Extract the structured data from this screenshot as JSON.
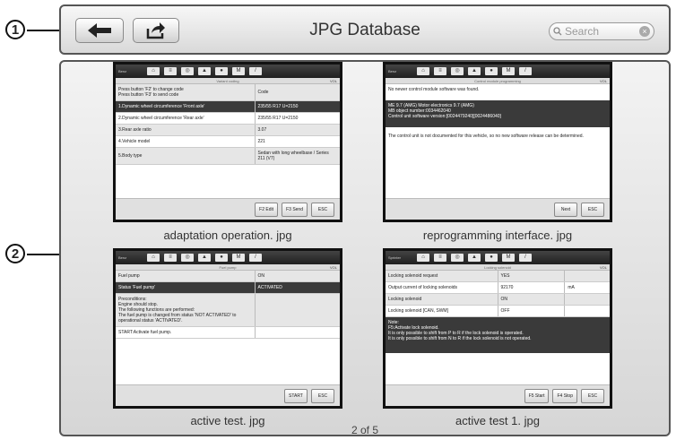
{
  "callouts": {
    "one": "1",
    "two": "2"
  },
  "toolbar": {
    "title": "JPG Database",
    "search_placeholder": "Search",
    "back_icon": "back-arrow-icon",
    "share_icon": "share-icon",
    "clear_icon": "clear-icon"
  },
  "thumbnails": [
    {
      "caption": "adaptation operation. jpg",
      "subtitle": "Variant coding",
      "header": [
        "Press button 'F2' to change code\nPress button 'F3' to send code",
        "Code"
      ],
      "rows": [
        [
          "1.Dynamic wheel circumference 'Front axle'",
          "235/55 R17 U=2150"
        ],
        [
          "2.Dynamic wheel circumference 'Rear axle'",
          "235/55 R17 U=2150"
        ],
        [
          "3.Rear axle ratio",
          "3.07"
        ],
        [
          "4.Vehicle model",
          "221"
        ],
        [
          "5.Body type",
          "Sedan with long wheelbase / Series 211 (V7)"
        ]
      ],
      "buttons": [
        "F2 Edit",
        "F3 Send",
        "ESC"
      ]
    },
    {
      "caption": "reprogramming interface. jpg",
      "subtitle": "Control module programming",
      "line1": "No newer control module software was found.",
      "block": "ME 9.7 (AMG) Motor electronics 9.7 (AMG)\nMB object number:0034462040\nControl unit software version:[0024479240][0024486040]",
      "line2": "The control unit is not documented for this vehicle, so no new software release can be determined.",
      "buttons": [
        "Next",
        "ESC"
      ]
    },
    {
      "caption": "active test. jpg",
      "subtitle": "Fuel pump",
      "rows": [
        [
          "Fuel pump",
          "ON"
        ],
        [
          "Status 'Fuel pump'",
          "ACTIVATED"
        ]
      ],
      "preconditions": "Preconditions:\n Engine should stop.\n The following functions are performed:\n The fuel pump is changed from status 'NOT ACTIVATED' to operational status 'ACTIVATED'.",
      "start_line": "START:Activate fuel pump.",
      "buttons": [
        "START",
        "ESC"
      ]
    },
    {
      "caption": "active test 1. jpg",
      "subtitle": "Locking solenoid",
      "rows": [
        [
          "Locking solenoid request",
          "YES",
          ""
        ],
        [
          "Output current of locking solenoids",
          "92170",
          "mA"
        ],
        [
          "Locking solenoid",
          "ON",
          ""
        ],
        [
          "Locking solenoid [CAN, SWM]",
          "OFF",
          ""
        ]
      ],
      "note": "Note:\n F5:Activate lock solenoid.\n It is only possible to shift from P to R if the lock solenoid is operated.\n It is only possible to shift from N to R if the lock solenoid is not operated.",
      "buttons": [
        "F5 Start",
        "F4 Stop",
        "ESC"
      ]
    }
  ],
  "pager": {
    "label": "2 of 5"
  }
}
